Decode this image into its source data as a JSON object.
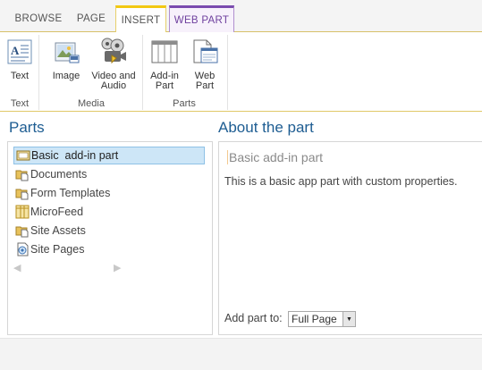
{
  "ribbon": {
    "tabs": [
      {
        "label": "BROWSE"
      },
      {
        "label": "PAGE"
      },
      {
        "label": "INSERT"
      },
      {
        "label": "WEB PART"
      }
    ],
    "groups": {
      "text": {
        "label": "Text",
        "buttons": [
          {
            "label": "Text",
            "icon": "text-icon"
          }
        ]
      },
      "media": {
        "label": "Media",
        "buttons": [
          {
            "label": "Image",
            "icon": "image-icon"
          },
          {
            "label": "Video and\nAudio",
            "icon": "video-audio-icon"
          }
        ]
      },
      "parts": {
        "label": "Parts",
        "buttons": [
          {
            "label": "Add-in\nPart",
            "icon": "add-in-part-icon"
          },
          {
            "label": "Web\nPart",
            "icon": "web-part-icon"
          }
        ]
      }
    },
    "colors": {
      "insert_accent": "#f2c811",
      "webpart_accent": "#7a4cae"
    }
  },
  "parts": {
    "title": "Parts",
    "items": [
      {
        "label": "Basic  add-in part",
        "icon": "add-in-part-icon",
        "selected": true
      },
      {
        "label": "Documents",
        "icon": "document-library-icon"
      },
      {
        "label": "Form Templates",
        "icon": "document-library-icon"
      },
      {
        "label": "MicroFeed",
        "icon": "list-icon"
      },
      {
        "label": "Site Assets",
        "icon": "document-library-icon"
      },
      {
        "label": "Site Pages",
        "icon": "wiki-page-library-icon"
      }
    ],
    "nav": {
      "prev": "◀",
      "next": "▶"
    }
  },
  "about": {
    "title": "About the part",
    "part_name": "Basic add-in part",
    "description": "This is a basic app part with custom properties.",
    "add_part_label": "Add part to:",
    "add_part_value": "Full Page"
  }
}
